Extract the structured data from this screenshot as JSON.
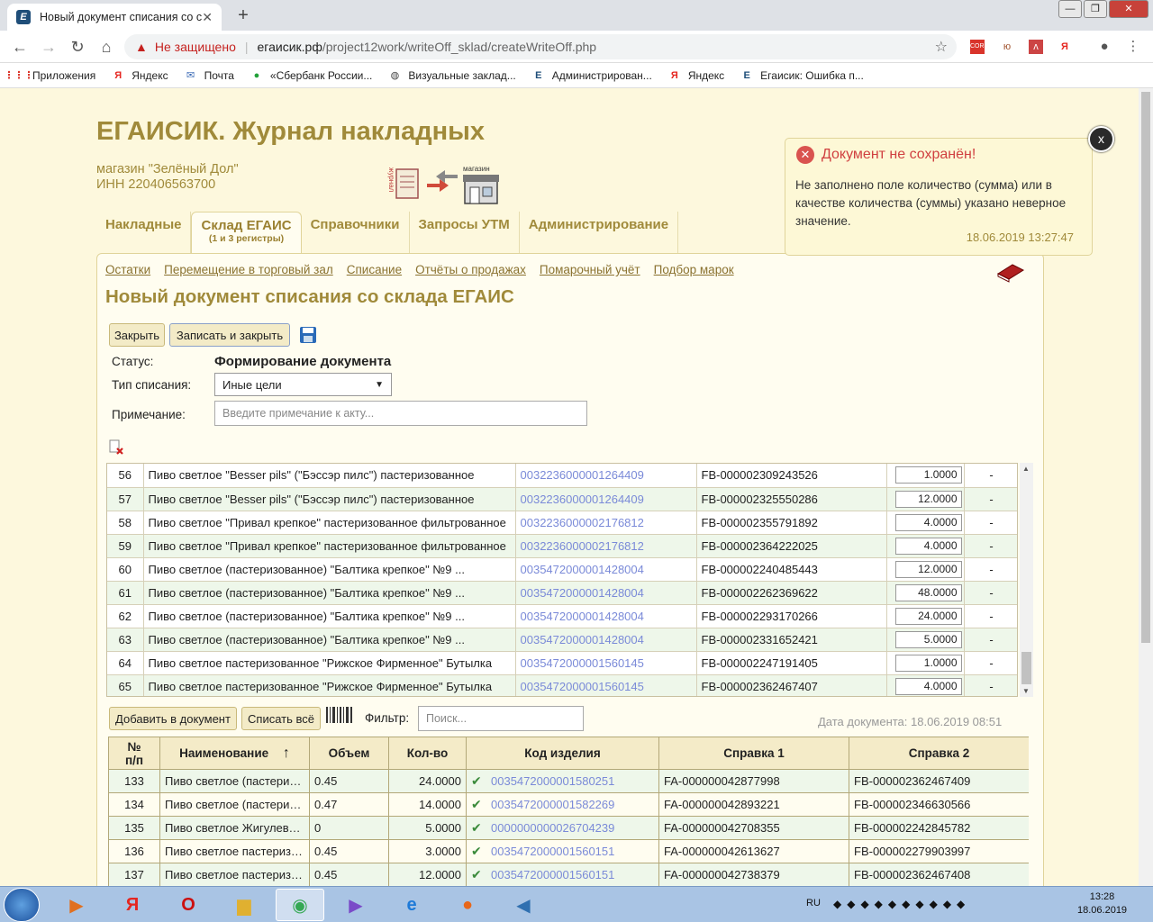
{
  "browser": {
    "tab_title": "Новый документ списания со с",
    "tab_close": "✕",
    "new_tab": "+",
    "win_min": "—",
    "win_max": "❐",
    "win_close": "✕",
    "security_text": "Не защищено",
    "url_host": "егаисик.рф",
    "url_path": "/project12work/writeOff_sklad/createWriteOff.php",
    "ext_labels": [
      "CORS",
      "ю",
      "ʌ",
      "Я",
      "●",
      "⋮"
    ],
    "bookmarks": [
      {
        "icon": "apps-icon",
        "glyph": "⋮⋮⋮",
        "color": "#d93025",
        "label": "Приложения"
      },
      {
        "icon": "yandex-icon",
        "glyph": "Я",
        "color": "#e52620",
        "label": "Яндекс"
      },
      {
        "icon": "mail-icon",
        "glyph": "✉",
        "color": "#3b6ab5",
        "label": "Почта"
      },
      {
        "icon": "sberbank-icon",
        "glyph": "●",
        "color": "#21a038",
        "label": "«Сбербанк России..."
      },
      {
        "icon": "globe-icon",
        "glyph": "◍",
        "color": "#444",
        "label": "Визуальные заклад..."
      },
      {
        "icon": "egais-icon",
        "glyph": "E",
        "color": "#1f4e79",
        "label": "Администрирован..."
      },
      {
        "icon": "yandex-icon",
        "glyph": "Я",
        "color": "#e52620",
        "label": "Яндекс"
      },
      {
        "icon": "egais-icon",
        "glyph": "E",
        "color": "#1f4e79",
        "label": "Егаисик: Ошибка п..."
      }
    ]
  },
  "header": {
    "title": "ЕГАИСИК. Журнал накладных",
    "shop_name": "магазин \"Зелёный Дол\"",
    "inn": "ИНН 220406563700",
    "logo_left_text": "журнал",
    "logo_right_text": "магазин"
  },
  "nav": {
    "tabs": [
      {
        "label": "Накладные",
        "sub": ""
      },
      {
        "label": "Склад ЕГАИС",
        "sub": "(1 и 3 регистры)"
      },
      {
        "label": "Справочники",
        "sub": ""
      },
      {
        "label": "Запросы УТМ",
        "sub": ""
      },
      {
        "label": "Администрирование",
        "sub": ""
      }
    ],
    "subnav": [
      "Остатки",
      "Перемещение в торговый зал",
      "Списание",
      "Отчёты о продажах",
      "Помарочный учёт",
      "Подбор марок"
    ]
  },
  "doc": {
    "title": "Новый документ списания со склада ЕГАИС",
    "close_btn": "Закрыть",
    "save_close_btn": "Записать и закрыть",
    "status_label": "Статус:",
    "status_value": "Формирование документа",
    "type_label": "Тип списания:",
    "type_value": "Иные цели",
    "note_label": "Примечание:",
    "note_placeholder": "Введите примечание к акту...",
    "add_btn": "Добавить в документ",
    "remove_all_btn": "Списать всё",
    "filter_label": "Фильтр:",
    "filter_placeholder": "Поиск...",
    "doc_date": "Дата документа: 18.06.2019 08:51"
  },
  "stock_rows": [
    {
      "n": "56",
      "name": "Пиво светлое \"Besser pils\" (\"Бэссэр пилс\") пастеризованное",
      "code": "0032236000001264409",
      "ref": "FB-000002309243526",
      "qty": "1.0000",
      "dash": "-"
    },
    {
      "n": "57",
      "name": "Пиво светлое \"Besser pils\" (\"Бэссэр пилс\") пастеризованное",
      "code": "0032236000001264409",
      "ref": "FB-000002325550286",
      "qty": "12.0000",
      "dash": "-"
    },
    {
      "n": "58",
      "name": "Пиво светлое \"Привал крепкое\" пастеризованное фильтрованное",
      "code": "0032236000002176812",
      "ref": "FB-000002355791892",
      "qty": "4.0000",
      "dash": "-"
    },
    {
      "n": "59",
      "name": "Пиво светлое \"Привал крепкое\" пастеризованное фильтрованное",
      "code": "0032236000002176812",
      "ref": "FB-000002364222025",
      "qty": "4.0000",
      "dash": "-"
    },
    {
      "n": "60",
      "name": "Пиво светлое (пастеризованное) \"Балтика крепкое\" №9 ...",
      "code": "0035472000001428004",
      "ref": "FB-000002240485443",
      "qty": "12.0000",
      "dash": "-"
    },
    {
      "n": "61",
      "name": "Пиво светлое (пастеризованное) \"Балтика крепкое\" №9 ...",
      "code": "0035472000001428004",
      "ref": "FB-000002262369622",
      "qty": "48.0000",
      "dash": "-"
    },
    {
      "n": "62",
      "name": "Пиво светлое (пастеризованное) \"Балтика крепкое\" №9 ...",
      "code": "0035472000001428004",
      "ref": "FB-000002293170266",
      "qty": "24.0000",
      "dash": "-"
    },
    {
      "n": "63",
      "name": "Пиво светлое (пастеризованное) \"Балтика крепкое\" №9 ...",
      "code": "0035472000001428004",
      "ref": "FB-000002331652421",
      "qty": "5.0000",
      "dash": "-"
    },
    {
      "n": "64",
      "name": "Пиво светлое пастеризованное \"Рижское Фирменное\" Бутылка",
      "code": "0035472000001560145",
      "ref": "FB-000002247191405",
      "qty": "1.0000",
      "dash": "-"
    },
    {
      "n": "65",
      "name": "Пиво светлое пастеризованное \"Рижское Фирменное\" Бутылка",
      "code": "0035472000001560145",
      "ref": "FB-000002362467407",
      "qty": "4.0000",
      "dash": "-"
    }
  ],
  "doc_table": {
    "headers": [
      "№\nп/п",
      "Наименование",
      "Объем",
      "Кол-во",
      "Код изделия",
      "Справка 1",
      "Справка 2"
    ],
    "sort_arrow": "↑",
    "rows": [
      {
        "n": "133",
        "name": "Пиво светлое (пастеризованное)",
        "vol": "0.45",
        "qty": "24.0000",
        "code": "0035472000001580251",
        "ref1": "FA-000000042877998",
        "ref2": "FB-000002362467409"
      },
      {
        "n": "134",
        "name": "Пиво светлое (пастеризованное)",
        "vol": "0.47",
        "qty": "14.0000",
        "code": "0035472000001582269",
        "ref1": "FA-000000042893221",
        "ref2": "FB-000002346630566"
      },
      {
        "n": "135",
        "name": "Пиво светлое Жигулевское",
        "vol": "0",
        "qty": "5.0000",
        "code": "0000000000026704239",
        "ref1": "FA-000000042708355",
        "ref2": "FB-000002242845782"
      },
      {
        "n": "136",
        "name": "Пиво светлое пастеризованное",
        "vol": "0.45",
        "qty": "3.0000",
        "code": "0035472000001560151",
        "ref1": "FA-000000042613627",
        "ref2": "FB-000002279903997"
      },
      {
        "n": "137",
        "name": "Пиво светлое пастеризованное",
        "vol": "0.45",
        "qty": "12.0000",
        "code": "0035472000001560151",
        "ref1": "FA-000000042738379",
        "ref2": "FB-000002362467408"
      }
    ]
  },
  "toast": {
    "title": "Документ не сохранён!",
    "message": "Не заполнено поле количество (сумма) или в качестве количества (суммы) указано неверное значение.",
    "date": "18.06.2019 13:27:47",
    "close": "x"
  },
  "taskbar": {
    "lang": "RU",
    "time": "13:28",
    "date": "18.06.2019",
    "apps": [
      {
        "name": "media-player-icon",
        "glyph": "▶",
        "color": "#e07020"
      },
      {
        "name": "yandex-browser-icon",
        "glyph": "Я",
        "color": "#e52620"
      },
      {
        "name": "opera-icon",
        "glyph": "O",
        "color": "#cc1010"
      },
      {
        "name": "explorer-icon",
        "glyph": "▆",
        "color": "#e0b030"
      },
      {
        "name": "chrome-icon",
        "glyph": "◉",
        "color": "#34a853"
      },
      {
        "name": "visual-studio-icon",
        "glyph": "▶",
        "color": "#7a4ac8"
      },
      {
        "name": "ie-icon",
        "glyph": "e",
        "color": "#1e7ad8"
      },
      {
        "name": "firefox-icon",
        "glyph": "●",
        "color": "#e8671a"
      },
      {
        "name": "speaker-app-icon",
        "glyph": "◀",
        "color": "#3070b0"
      }
    ]
  }
}
